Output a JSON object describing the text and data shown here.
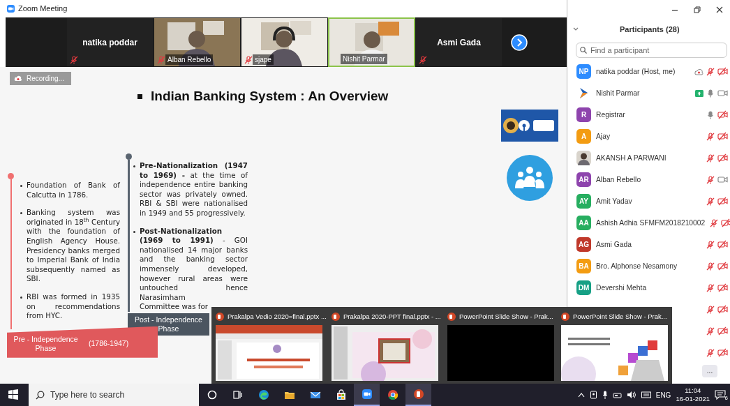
{
  "window": {
    "title": "Zoom Meeting"
  },
  "video_strip": {
    "tiles": [
      {
        "kind": "name",
        "name": "natika poddar",
        "muted": true,
        "active": false
      },
      {
        "kind": "video",
        "name": "Alban Rebello",
        "muted": true,
        "active": false
      },
      {
        "kind": "video",
        "name": "sjape",
        "muted": true,
        "active": false
      },
      {
        "kind": "video",
        "name": "Nishit Parmar",
        "muted": false,
        "active": true
      },
      {
        "kind": "name",
        "name": "Asmi Gada",
        "muted": true,
        "active": false
      }
    ]
  },
  "recording": {
    "label": "Recording..."
  },
  "slide": {
    "title": "Indian Banking System : An Overview",
    "pre_phase": {
      "bullets": [
        "Foundation of Bank of Calcutta in 1786.",
        "Banking system was originated in 18$^{th}$ Century with the foundation of English Agency House. Presidency banks merged to Imperial Bank of India subsequently named as SBI.",
        "RBI was formed in 1935 on recommendations from HYC."
      ],
      "label": "Pre - Independence Phase",
      "years": "(1786-1947)"
    },
    "post_phase": {
      "bullets": [
        "**Pre-Nationalization (1947 to 1969) -** at the time of independence entire banking sector was privately owned. RBI & SBI were nationalised in 1949 and 55 progressively.",
        "**Post-Nationalization (1969 to 1991)** - GOI nationalised 14 major banks and the banking sector immensely developed, however rural areas were untouched hence Narasimham"
      ],
      "last_line": "Committee was for",
      "label": "Post - Independence Phase"
    }
  },
  "participants": {
    "title": "Participants (28)",
    "search": {
      "placeholder": "Find a participant"
    },
    "rows": [
      {
        "kind": "initials",
        "initials": "NP",
        "color": "#2d8cff",
        "name": "natika poddar (Host, me)",
        "recording": true,
        "mic_muted": true,
        "video_off": true
      },
      {
        "kind": "logo",
        "name": "Nishit Parmar",
        "sharing": true,
        "mic_muted": false,
        "video_off": false
      },
      {
        "kind": "initials",
        "initials": "R",
        "color": "#8e44ad",
        "name": "Registrar",
        "mic_muted": false,
        "video_off": true
      },
      {
        "kind": "initials",
        "initials": "A",
        "color": "#f39c12",
        "name": "Ajay",
        "mic_muted": true,
        "video_off": true
      },
      {
        "name": "AKANSH A PARWANI",
        "mic_muted": true,
        "video_off": true
      },
      {
        "kind": "initials",
        "initials": "AR",
        "color": "#8e44ad",
        "name": "Alban Rebello",
        "mic_muted": true,
        "video_off": false
      },
      {
        "kind": "initials",
        "initials": "AY",
        "color": "#27ae60",
        "name": "Amit Yadav",
        "mic_muted": true,
        "video_off": true
      },
      {
        "kind": "initials",
        "initials": "AA",
        "color": "#27ae60",
        "name": "Ashish Adhia SFMFM2018210002",
        "mic_muted": true,
        "video_off": true
      },
      {
        "kind": "initials",
        "initials": "AG",
        "color": "#c0392b",
        "name": "Asmi Gada",
        "mic_muted": true,
        "video_off": true
      },
      {
        "kind": "initials",
        "initials": "BA",
        "color": "#f39c12",
        "name": "Bro. Alphonse Nesamony",
        "mic_muted": true,
        "video_off": true
      },
      {
        "kind": "initials",
        "initials": "DM",
        "color": "#16a085",
        "name": "Devershi Mehta",
        "mic_muted": true,
        "video_off": true
      },
      {
        "kind": "hidden",
        "mic_muted": true,
        "video_off": true
      },
      {
        "kind": "hidden",
        "mic_muted": true,
        "video_off": true
      },
      {
        "kind": "hidden",
        "mic_muted": true,
        "video_off": true
      }
    ],
    "more": "..."
  },
  "taskbar_previews": [
    {
      "title": "Prakalpa Vedio 2020=final.pptx ...",
      "kind": "picture"
    },
    {
      "title": "Prakalpa  2020-PPT final.pptx - ...",
      "kind": "picture"
    },
    {
      "title": "PowerPoint Slide Show  -  Prak...",
      "kind": "blank"
    },
    {
      "title": "PowerPoint Slide Show  -  Prak...",
      "kind": "picture"
    }
  ],
  "taskbar": {
    "search": {
      "placeholder": "Type here to search"
    },
    "apps": [
      {
        "kind": "cortana",
        "active": false
      },
      {
        "kind": "taskview",
        "active": false
      },
      {
        "kind": "edge",
        "active": false
      },
      {
        "kind": "explorer",
        "active": false
      },
      {
        "kind": "mail",
        "active": false
      },
      {
        "kind": "store",
        "active": false
      },
      {
        "kind": "zoom",
        "active": true
      },
      {
        "kind": "chrome",
        "active": false
      },
      {
        "kind": "powerpoint",
        "active": true
      }
    ],
    "language": "ENG",
    "time": "11:04",
    "date": "16-01-2021",
    "notifications": "6"
  }
}
